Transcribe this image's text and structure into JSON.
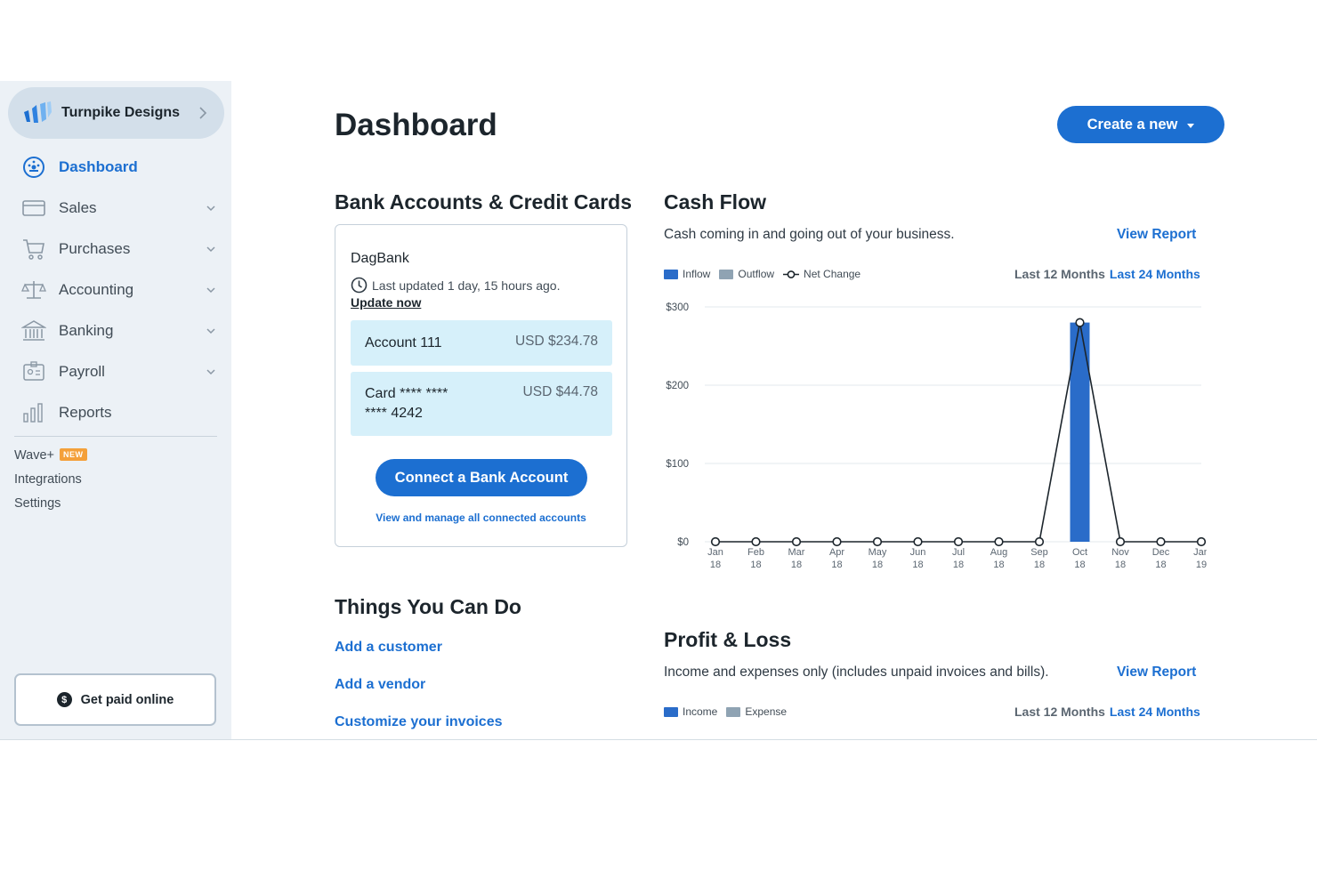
{
  "sidebar": {
    "business_name": "Turnpike Designs",
    "nav": [
      {
        "label": "Dashboard",
        "icon": "dashboard-icon",
        "active": true
      },
      {
        "label": "Sales",
        "icon": "sales-icon"
      },
      {
        "label": "Purchases",
        "icon": "cart-icon"
      },
      {
        "label": "Accounting",
        "icon": "scale-icon"
      },
      {
        "label": "Banking",
        "icon": "bank-icon"
      },
      {
        "label": "Payroll",
        "icon": "payroll-icon"
      },
      {
        "label": "Reports",
        "icon": "bar-chart-icon"
      }
    ],
    "wave_plus": "Wave+",
    "new_badge": "NEW",
    "integrations": "Integrations",
    "settings": "Settings",
    "get_paid": "Get paid online"
  },
  "header": {
    "title": "Dashboard",
    "create_button": "Create a new"
  },
  "bank": {
    "heading": "Bank Accounts & Credit Cards",
    "bank_name": "DagBank",
    "last_updated": "Last updated 1 day, 15 hours ago.",
    "update_now": "Update now",
    "accounts": [
      {
        "name": "Account 111",
        "value": "USD $234.78"
      },
      {
        "name_line1": "Card **** ****",
        "name_line2": "**** 4242",
        "value": "USD $44.78"
      }
    ],
    "connect_button": "Connect a Bank Account",
    "manage_link": "View and manage all connected accounts"
  },
  "things": {
    "heading": "Things You Can Do",
    "items": [
      "Add a customer",
      "Add a vendor",
      "Customize your invoices"
    ]
  },
  "cashflow": {
    "heading": "Cash Flow",
    "description": "Cash coming in and going out of your business.",
    "view_report": "View Report",
    "legend": {
      "inflow": "Inflow",
      "outflow": "Outflow",
      "net": "Net Change"
    },
    "range_12": "Last 12 Months",
    "range_24": "Last 24 Months"
  },
  "profitloss": {
    "heading": "Profit & Loss",
    "description": "Income and expenses only (includes unpaid invoices and bills).",
    "view_report": "View Report",
    "legend": {
      "income": "Income",
      "expense": "Expense"
    },
    "range_12": "Last 12 Months",
    "range_24": "Last 24 Months"
  },
  "colors": {
    "accent": "#1c6fd1",
    "inflow": "#2a6cc9",
    "outflow": "#8fa3b3",
    "sidebar_bg": "#ecf1f6"
  },
  "chart_data": {
    "type": "bar",
    "title": "Cash Flow",
    "categories": [
      "Jan 18",
      "Feb 18",
      "Mar 18",
      "Apr 18",
      "May 18",
      "Jun 18",
      "Jul 18",
      "Aug 18",
      "Sep 18",
      "Oct 18",
      "Nov 18",
      "Dec 18",
      "Jan 19"
    ],
    "category_lines": [
      [
        "Jan",
        "18"
      ],
      [
        "Feb",
        "18"
      ],
      [
        "Mar",
        "18"
      ],
      [
        "Apr",
        "18"
      ],
      [
        "May",
        "18"
      ],
      [
        "Jun",
        "18"
      ],
      [
        "Jul",
        "18"
      ],
      [
        "Aug",
        "18"
      ],
      [
        "Sep",
        "18"
      ],
      [
        "Oct",
        "18"
      ],
      [
        "Nov",
        "18"
      ],
      [
        "Dec",
        "18"
      ],
      [
        "Jan",
        "19"
      ]
    ],
    "series": [
      {
        "name": "Inflow",
        "kind": "bar",
        "values": [
          0,
          0,
          0,
          0,
          0,
          0,
          0,
          0,
          0,
          280,
          0,
          0,
          0
        ]
      },
      {
        "name": "Outflow",
        "kind": "bar",
        "values": [
          0,
          0,
          0,
          0,
          0,
          0,
          0,
          0,
          0,
          0,
          0,
          0,
          0
        ]
      },
      {
        "name": "Net Change",
        "kind": "line",
        "values": [
          0,
          0,
          0,
          0,
          0,
          0,
          0,
          0,
          0,
          280,
          0,
          0,
          0
        ]
      }
    ],
    "yticks": [
      0,
      100,
      200,
      300
    ],
    "ytick_labels": [
      "$0",
      "$100",
      "$200",
      "$300"
    ],
    "ylim": [
      0,
      300
    ],
    "grid": true,
    "legend": "top-left"
  }
}
